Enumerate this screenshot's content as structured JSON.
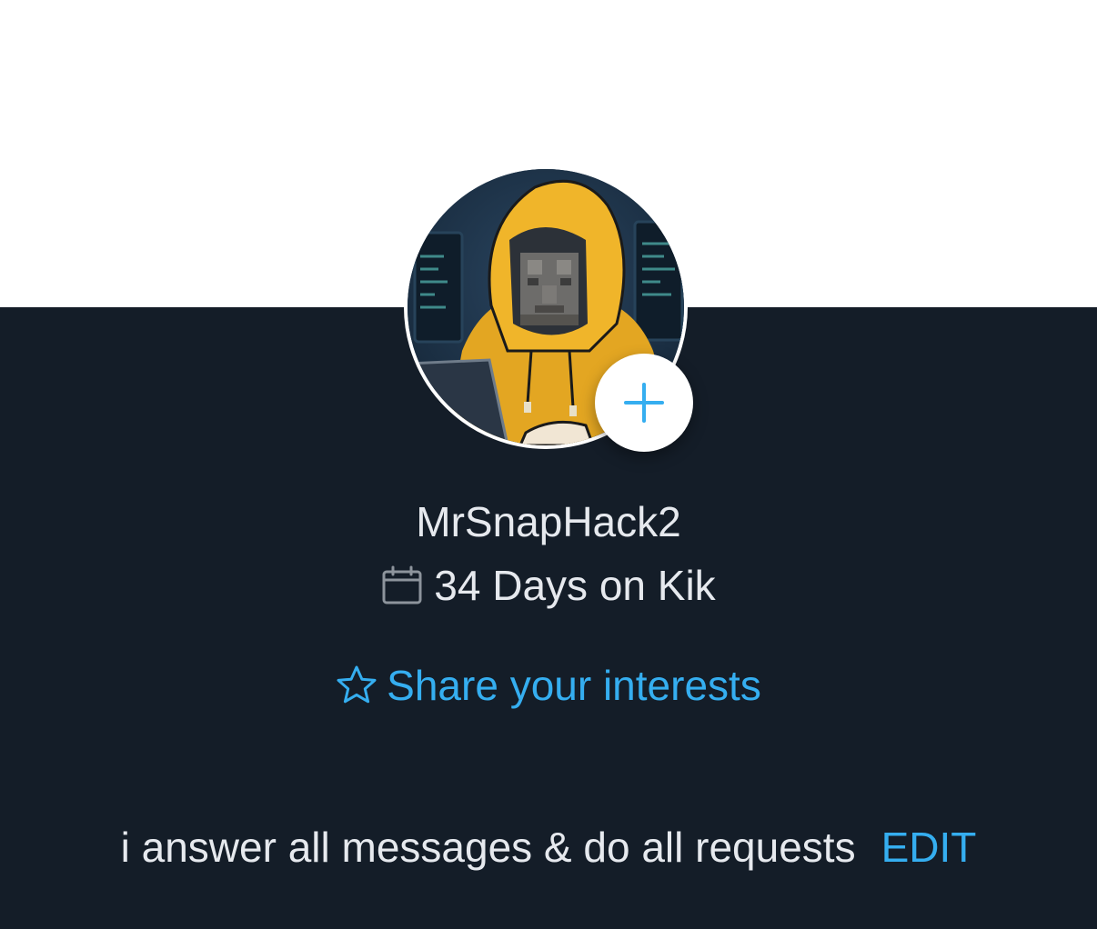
{
  "profile": {
    "username": "MrSnapHack2",
    "days_on_kik": "34 Days on Kik",
    "share_interests_label": "Share your interests",
    "bio": "i answer all messages & do all requests",
    "edit_label": "EDIT"
  },
  "icons": {
    "add_photo": "plus-icon",
    "calendar": "calendar-icon",
    "star": "star-icon"
  },
  "colors": {
    "accent": "#35aef0",
    "background_dark": "#141d28",
    "background_light": "#ffffff",
    "text_primary": "#e6e9ee"
  }
}
